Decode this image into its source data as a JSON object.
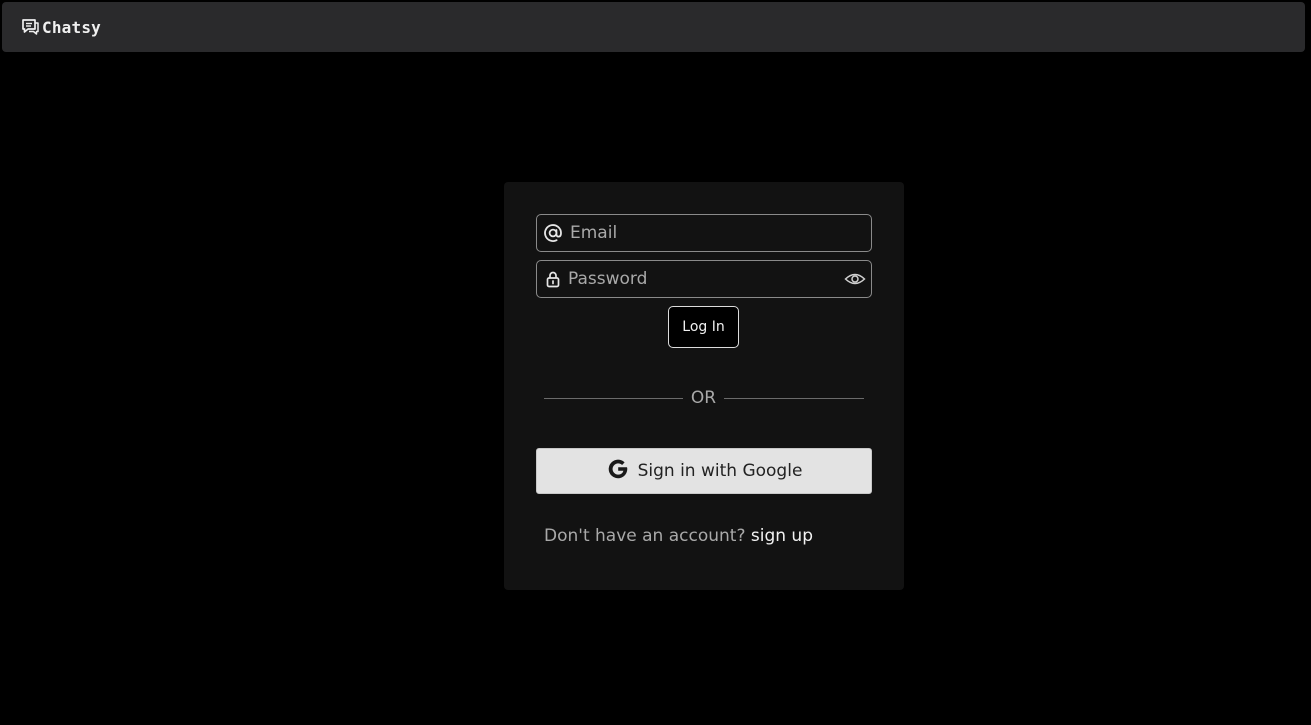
{
  "app": {
    "name": "Chatsy"
  },
  "icons": {
    "brand": "chat-icon",
    "email": "at-sign-icon",
    "password": "lock-icon",
    "toggle_password": "eye-icon",
    "google": "google-icon"
  },
  "colors": {
    "background": "#000000",
    "navbar": "#2a2a2c",
    "card": "#121212",
    "google_button": "#e3e3e3"
  },
  "login_form": {
    "email_placeholder": "Email",
    "email_value": "",
    "password_placeholder": "Password",
    "password_value": "",
    "login_label": "Log In",
    "divider_text": "OR",
    "google_label": "Sign in with Google",
    "signup_prompt": "Don't have an account?",
    "signup_link": "sign up"
  }
}
